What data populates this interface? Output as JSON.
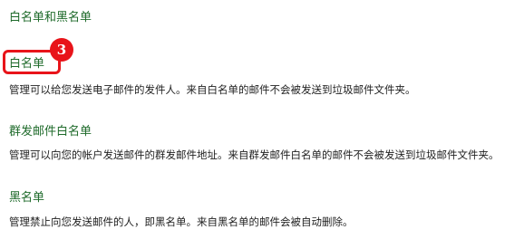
{
  "page_title": "白名单和黑名单",
  "sections": [
    {
      "title": "白名单",
      "description": "管理可以给您发送电子邮件的发件人。来自白名单的邮件不会被发送到垃圾邮件文件夹。"
    },
    {
      "title": "群发邮件白名单",
      "description": "管理可以向您的帐户发送邮件的群发邮件地址。来自群发邮件白名单的邮件不会被发送到垃圾邮件文件夹。"
    },
    {
      "title": "黑名单",
      "description": "管理禁止向您发送邮件的人，即黑名单。来自黑名单的邮件会被自动删除。"
    }
  ],
  "annotation": {
    "badge_number": "3",
    "color": "#e8141a"
  },
  "colors": {
    "link_green": "#1e6a2a",
    "text": "#222222"
  }
}
